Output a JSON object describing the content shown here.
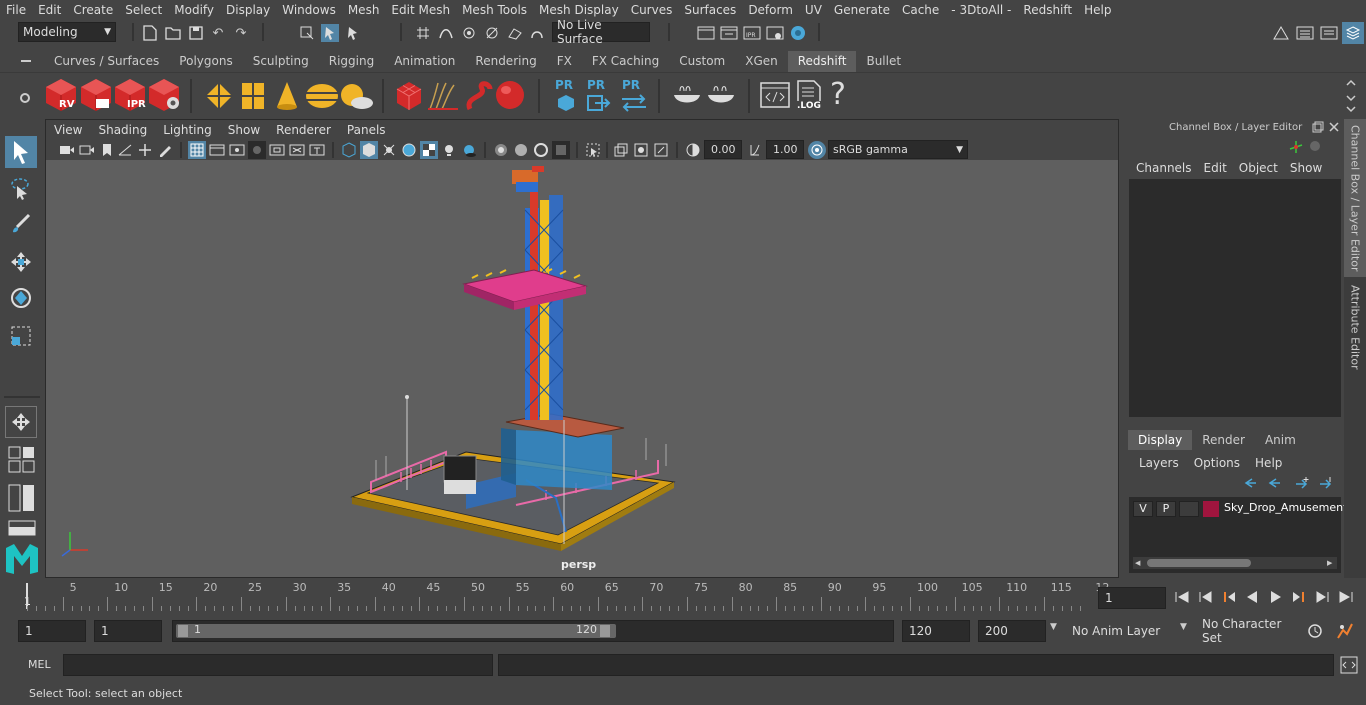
{
  "menubar": {
    "items": [
      "File",
      "Edit",
      "Create",
      "Select",
      "Modify",
      "Display",
      "Windows",
      "Mesh",
      "Edit Mesh",
      "Mesh Tools",
      "Mesh Display",
      "Curves",
      "Surfaces",
      "Deform",
      "UV",
      "Generate",
      "Cache",
      "- 3DtoAll -",
      "Redshift",
      "Help"
    ]
  },
  "statusline": {
    "mode": "Modeling",
    "live_surface": "No Live Surface"
  },
  "shelf": {
    "tabs": [
      "Curves / Surfaces",
      "Polygons",
      "Sculpting",
      "Rigging",
      "Animation",
      "Rendering",
      "FX",
      "FX Caching",
      "Custom",
      "XGen",
      "Redshift",
      "Bullet"
    ],
    "active_tab": "Redshift",
    "rv_label": "RV",
    "ipr_label": "IPR",
    "pr_label": "PR",
    "log_label": ".LOG",
    "help_glyph": "?"
  },
  "viewport": {
    "menu": [
      "View",
      "Shading",
      "Lighting",
      "Show",
      "Renderer",
      "Panels"
    ],
    "exposure": "0.00",
    "gamma": "1.00",
    "colorspace": "sRGB gamma",
    "camera_label": "persp"
  },
  "channelbox": {
    "title": "Channel Box / Layer Editor",
    "menu": [
      "Channels",
      "Edit",
      "Object",
      "Show"
    ],
    "layer_tabs": [
      "Display",
      "Render",
      "Anim"
    ],
    "layer_menu": [
      "Layers",
      "Options",
      "Help"
    ],
    "layer": {
      "v": "V",
      "p": "P",
      "name": "Sky_Drop_Amusement",
      "color": "#a0153e"
    }
  },
  "sidetabs": [
    "Channel Box / Layer Editor",
    "Attribute Editor"
  ],
  "timeline": {
    "ticks": [
      "5",
      "10",
      "15",
      "20",
      "25",
      "30",
      "35",
      "40",
      "45",
      "50",
      "55",
      "60",
      "65",
      "70",
      "75",
      "80",
      "85",
      "90",
      "95",
      "100",
      "105",
      "110",
      "115",
      "12"
    ],
    "start_marker": "1",
    "current_frame": "1"
  },
  "range": {
    "start": "1",
    "playback_start": "1",
    "slider_start": "1",
    "slider_end": "120",
    "playback_end": "120",
    "end": "200",
    "anim_layer": "No Anim Layer",
    "character_set": "No Character Set"
  },
  "cmdline": {
    "lang": "MEL"
  },
  "helpline": {
    "text": "Select Tool: select an object"
  },
  "colors": {
    "accent": "#5285a6",
    "panel": "#444444",
    "viewport_bg": "#5f5f5f",
    "redshift_red": "#d32a2a"
  }
}
